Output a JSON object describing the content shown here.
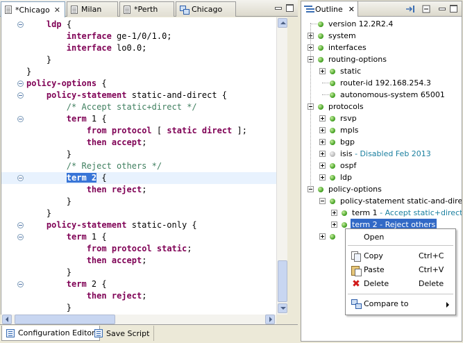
{
  "editor": {
    "tabs": [
      {
        "label": "*Chicago",
        "close": "✕"
      },
      {
        "label": "Milan"
      },
      {
        "label": "*Perth"
      },
      {
        "label": "Chicago"
      }
    ],
    "code_lines": [
      [
        {
          "t": "    "
        },
        {
          "t": "ldp",
          "c": "kw"
        },
        {
          "t": " {"
        }
      ],
      [
        {
          "t": "        "
        },
        {
          "t": "interface",
          "c": "kw"
        },
        {
          "t": " ge-1/0/1.0;"
        }
      ],
      [
        {
          "t": "        "
        },
        {
          "t": "interface",
          "c": "kw"
        },
        {
          "t": " lo0.0;"
        }
      ],
      [
        {
          "t": "    }"
        }
      ],
      [
        {
          "t": "}"
        }
      ],
      [
        {
          "t": "policy-options",
          "c": "kw"
        },
        {
          "t": " {"
        }
      ],
      [
        {
          "t": "    "
        },
        {
          "t": "policy-statement",
          "c": "kw"
        },
        {
          "t": " static-and-direct {"
        }
      ],
      [
        {
          "t": "        "
        },
        {
          "t": "/* Accept static+direct */",
          "c": "cm"
        }
      ],
      [
        {
          "t": "        "
        },
        {
          "t": "term",
          "c": "kw"
        },
        {
          "t": " 1 {"
        }
      ],
      [
        {
          "t": "            "
        },
        {
          "t": "from",
          "c": "kw"
        },
        {
          "t": " "
        },
        {
          "t": "protocol",
          "c": "kw"
        },
        {
          "t": " [ "
        },
        {
          "t": "static",
          "c": "kw"
        },
        {
          "t": " "
        },
        {
          "t": "direct",
          "c": "kw"
        },
        {
          "t": " ];"
        }
      ],
      [
        {
          "t": "            "
        },
        {
          "t": "then",
          "c": "kw"
        },
        {
          "t": " "
        },
        {
          "t": "accept",
          "c": "kw"
        },
        {
          "t": ";"
        }
      ],
      [
        {
          "t": "        }"
        }
      ],
      [
        {
          "t": "        "
        },
        {
          "t": "/* Reject others */",
          "c": "cm"
        }
      ],
      [
        {
          "t": "        "
        },
        {
          "t": "term 2",
          "c": "kw sel"
        },
        {
          "t": " {"
        }
      ],
      [
        {
          "t": "            "
        },
        {
          "t": "then",
          "c": "kw"
        },
        {
          "t": " "
        },
        {
          "t": "reject",
          "c": "kw"
        },
        {
          "t": ";"
        }
      ],
      [
        {
          "t": "        }"
        }
      ],
      [
        {
          "t": "    }"
        }
      ],
      [
        {
          "t": "    "
        },
        {
          "t": "policy-statement",
          "c": "kw"
        },
        {
          "t": " static-only {"
        }
      ],
      [
        {
          "t": "        "
        },
        {
          "t": "term",
          "c": "kw"
        },
        {
          "t": " 1 {"
        }
      ],
      [
        {
          "t": "            "
        },
        {
          "t": "from",
          "c": "kw"
        },
        {
          "t": " "
        },
        {
          "t": "protocol",
          "c": "kw"
        },
        {
          "t": " "
        },
        {
          "t": "static",
          "c": "kw"
        },
        {
          "t": ";"
        }
      ],
      [
        {
          "t": "            "
        },
        {
          "t": "then",
          "c": "kw"
        },
        {
          "t": " "
        },
        {
          "t": "accept",
          "c": "kw"
        },
        {
          "t": ";"
        }
      ],
      [
        {
          "t": "        }"
        }
      ],
      [
        {
          "t": "        "
        },
        {
          "t": "term",
          "c": "kw"
        },
        {
          "t": " 2 {"
        }
      ],
      [
        {
          "t": "            "
        },
        {
          "t": "then",
          "c": "kw"
        },
        {
          "t": " "
        },
        {
          "t": "reject",
          "c": "kw"
        },
        {
          "t": ";"
        }
      ],
      [
        {
          "t": "        }"
        }
      ]
    ],
    "fold_markers": [
      0,
      5,
      6,
      8,
      13,
      17,
      18,
      22
    ],
    "highlighted_line": 13,
    "bottom_tabs": [
      {
        "label": "Configuration Editor"
      },
      {
        "label": "Save Script"
      }
    ]
  },
  "outline": {
    "tab_label": "Outline",
    "close": "✕",
    "tree": [
      {
        "label": "version 12.2R2.4",
        "level": 0,
        "expander": "none"
      },
      {
        "label": "system",
        "level": 0,
        "expander": "plus"
      },
      {
        "label": "interfaces",
        "level": 0,
        "expander": "plus"
      },
      {
        "label": "routing-options",
        "level": 0,
        "expander": "minus"
      },
      {
        "label": "static",
        "level": 1,
        "expander": "plus"
      },
      {
        "label": "router-id 192.168.254.3",
        "level": 1,
        "expander": "none"
      },
      {
        "label": "autonomous-system 65001",
        "level": 1,
        "expander": "none"
      },
      {
        "label": "protocols",
        "level": 0,
        "expander": "minus"
      },
      {
        "label": "rsvp",
        "level": 1,
        "expander": "plus"
      },
      {
        "label": "mpls",
        "level": 1,
        "expander": "plus"
      },
      {
        "label": "bgp",
        "level": 1,
        "expander": "plus"
      },
      {
        "label": "isis",
        "desc": " - Disabled Feb 2013",
        "level": 1,
        "expander": "plus",
        "disabled": true
      },
      {
        "label": "ospf",
        "level": 1,
        "expander": "plus"
      },
      {
        "label": "ldp",
        "level": 1,
        "expander": "plus"
      },
      {
        "label": "policy-options",
        "level": 0,
        "expander": "minus"
      },
      {
        "label": "policy-statement static-and-direct",
        "level": 1,
        "expander": "minus"
      },
      {
        "label": "term 1",
        "desc": " - Accept static+direct",
        "level": 2,
        "expander": "plus"
      },
      {
        "label": "term 2 - Reject others",
        "level": 2,
        "expander": "plus",
        "selected": true
      },
      {
        "label": "",
        "level": 1,
        "expander": "plus"
      }
    ]
  },
  "context_menu": {
    "items": [
      {
        "label": "Open",
        "shortcut": "",
        "icon": ""
      },
      {
        "label": "Copy",
        "shortcut": "Ctrl+C",
        "icon": "copy-icon"
      },
      {
        "label": "Paste",
        "shortcut": "Ctrl+V",
        "icon": "paste-icon"
      },
      {
        "label": "Delete",
        "shortcut": "Delete",
        "icon": "delete-icon"
      },
      {
        "label": "Compare to",
        "shortcut": "",
        "icon": "compare-icon",
        "submenu": true
      }
    ]
  },
  "colors": {
    "keyword": "#7f0055",
    "comment": "#3f7f5f",
    "selection": "#3875d7",
    "tree_description": "#1a7f9f",
    "status_enabled": "#3a9a1a",
    "status_disabled": "#b3b3b3"
  }
}
